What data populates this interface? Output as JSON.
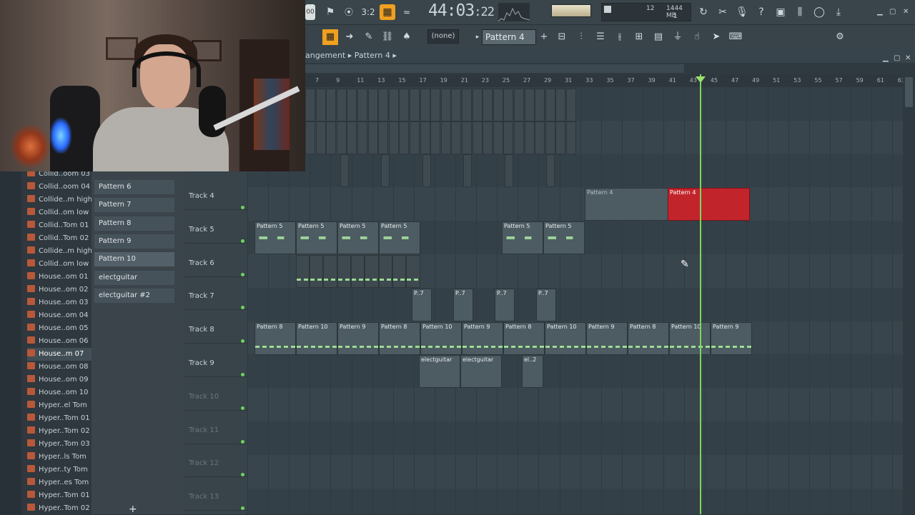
{
  "transport": {
    "time": "44:03",
    "time_sub": "22",
    "tempo_label": "3:2",
    "snap": "(none)",
    "pattern": "Pattern 4"
  },
  "memory": {
    "count": "12",
    "mb": "1444 MB",
    "cpu": "1"
  },
  "playlist": {
    "breadcrumb": "angement",
    "breadcrumb_pattern": "Pattern 4",
    "ruler": [
      "7",
      "9",
      "11",
      "13",
      "15",
      "17",
      "19",
      "21",
      "23",
      "25",
      "27",
      "29",
      "31",
      "33",
      "35",
      "37",
      "39",
      "41",
      "43",
      "45",
      "47",
      "49",
      "51",
      "53",
      "55",
      "57",
      "59",
      "61",
      "63"
    ]
  },
  "browser": {
    "items": [
      "Collid..oom 03",
      "Collid..oom 04",
      "Collide..m high",
      "Collid..om low",
      "Collid..Tom 01",
      "Collid..Tom 02",
      "Collide..m high",
      "Collid..om low",
      "House..om 01",
      "House..om 02",
      "House..om 03",
      "House..om 04",
      "House..om 05",
      "House..om 06",
      "House..m 07",
      "House..om 08",
      "House..om 09",
      "House..om 10",
      "Hyper..el Tom",
      "Hyper..Tom 01",
      "Hyper..Tom 02",
      "Hyper..Tom 03",
      "Hyper..ls Tom",
      "Hyper..ty Tom",
      "Hyper..es Tom",
      "Hyper..Tom 01",
      "Hyper..Tom 02"
    ],
    "selected_index": 14
  },
  "picker": {
    "items": [
      "Pattern 6",
      "Pattern 7",
      "Pattern 8",
      "Pattern 9",
      "Pattern 10",
      "electguitar",
      "electguitar #2"
    ],
    "current_index": 4
  },
  "tracks": [
    {
      "name": "Track 4",
      "dim": false
    },
    {
      "name": "Track 5",
      "dim": false
    },
    {
      "name": "Track 6",
      "dim": false
    },
    {
      "name": "Track 7",
      "dim": false
    },
    {
      "name": "Track 8",
      "dim": false
    },
    {
      "name": "Track 9",
      "dim": false
    },
    {
      "name": "Track 10",
      "dim": true
    },
    {
      "name": "Track 11",
      "dim": true
    },
    {
      "name": "Track 12",
      "dim": true
    },
    {
      "name": "Track 13",
      "dim": true
    }
  ],
  "clips": {
    "track4": [
      "Pattern 4",
      "Pattern 4"
    ],
    "track5": [
      "Pattern 5",
      "Pattern 5",
      "Pattern 5",
      "Pattern 5",
      "Pattern 5",
      "Pattern 5"
    ],
    "track7": [
      "P..7",
      "P..7",
      "P..7",
      "P..7"
    ],
    "track8": [
      "Pattern 8",
      "Pattern 10",
      "Pattern 9",
      "Pattern 8",
      "Pattern 10",
      "Pattern 9",
      "Pattern 8",
      "Pattern 10",
      "Pattern 9",
      "Pattern 8",
      "Pattern 10",
      "Pattern 9"
    ],
    "track9": [
      "electguitar",
      "electguitar",
      "el..2"
    ]
  },
  "colors": {
    "accent_green": "#7bd85a",
    "selected_clip": "#c2242c",
    "record_orange": "#f0a020"
  }
}
